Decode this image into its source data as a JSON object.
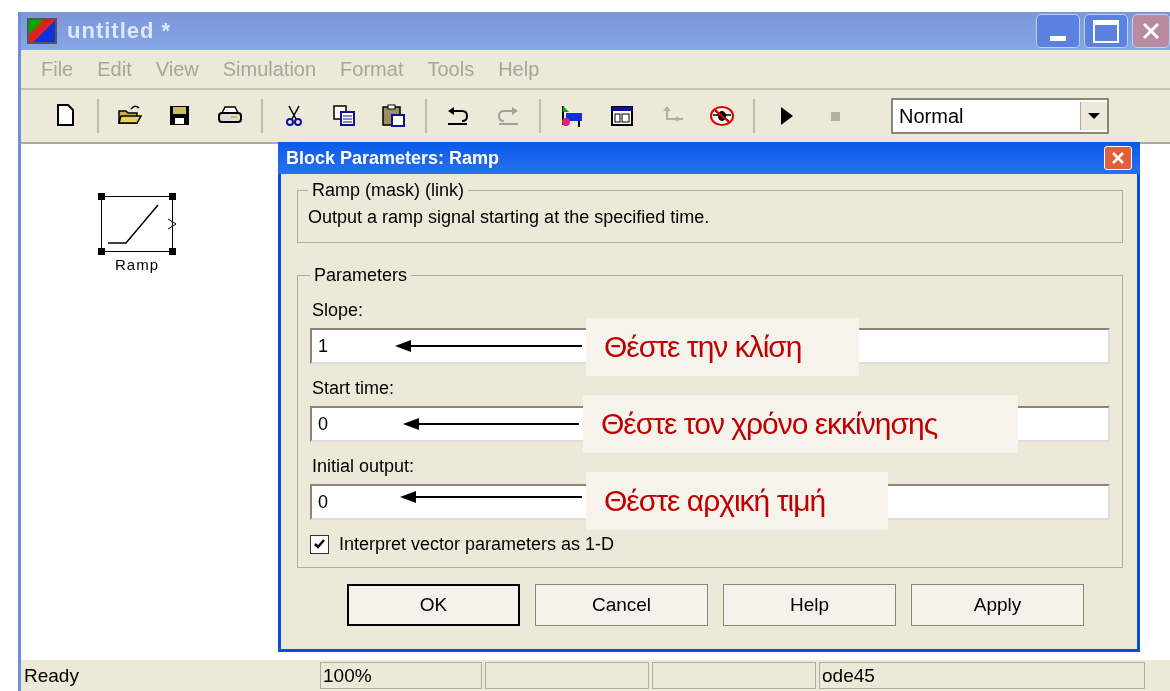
{
  "window": {
    "title": "untitled *"
  },
  "menu": [
    {
      "label": "File",
      "disabled": true
    },
    {
      "label": "Edit",
      "disabled": true
    },
    {
      "label": "View",
      "disabled": true
    },
    {
      "label": "Simulation",
      "disabled": true
    },
    {
      "label": "Format",
      "disabled": true
    },
    {
      "label": "Tools",
      "disabled": true
    },
    {
      "label": "Help",
      "disabled": true
    }
  ],
  "toolbar": [
    {
      "kind": "new",
      "disabled": false
    },
    {
      "kind": "separator"
    },
    {
      "kind": "open",
      "disabled": false
    },
    {
      "kind": "save",
      "disabled": false
    },
    {
      "kind": "print",
      "disabled": false
    },
    {
      "kind": "separator"
    },
    {
      "kind": "cut",
      "disabled": false
    },
    {
      "kind": "copy",
      "disabled": false
    },
    {
      "kind": "paste",
      "disabled": false
    },
    {
      "kind": "separator"
    },
    {
      "kind": "undo",
      "disabled": false
    },
    {
      "kind": "redo",
      "disabled": true
    },
    {
      "kind": "separator"
    },
    {
      "kind": "library",
      "disabled": false
    },
    {
      "kind": "explorer",
      "disabled": false
    },
    {
      "kind": "hierarchy",
      "disabled": true
    },
    {
      "kind": "debug",
      "disabled": false
    },
    {
      "kind": "separator"
    },
    {
      "kind": "play",
      "disabled": false
    },
    {
      "kind": "stop",
      "disabled": true
    }
  ],
  "sim_mode": {
    "value": "Normal"
  },
  "canvas": {
    "blocks": [
      {
        "label": "Ramp",
        "selected": true
      }
    ]
  },
  "dialog": {
    "title": "Block Parameters: Ramp",
    "description": {
      "title": "Ramp (mask) (link)",
      "text": "Output a ramp signal starting at the specified time."
    },
    "parameters": {
      "title": "Parameters",
      "fields": [
        {
          "label": "Slope:",
          "value": "1"
        },
        {
          "label": "Start time:",
          "value": "0"
        },
        {
          "label": "Initial output:",
          "value": "0"
        }
      ],
      "checkbox": {
        "label": "Interpret vector parameters as 1-D",
        "checked": true
      }
    },
    "buttons": [
      {
        "label": "OK",
        "default": true
      },
      {
        "label": "Cancel",
        "default": false
      },
      {
        "label": "Help",
        "default": false
      },
      {
        "label": "Apply",
        "default": false
      }
    ]
  },
  "annotations": [
    {
      "text": "Θέστε την κλίση"
    },
    {
      "text": "Θέστε τον χρόνο εκκίνησης"
    },
    {
      "text": "Θέστε αρχική τιμή"
    }
  ],
  "status_bar": {
    "panels": [
      {
        "kind": "text",
        "text": "Ready"
      },
      {
        "kind": "text",
        "text": "100%"
      },
      {
        "kind": "empty"
      },
      {
        "kind": "empty"
      },
      {
        "kind": "text",
        "text": "ode45"
      }
    ]
  }
}
